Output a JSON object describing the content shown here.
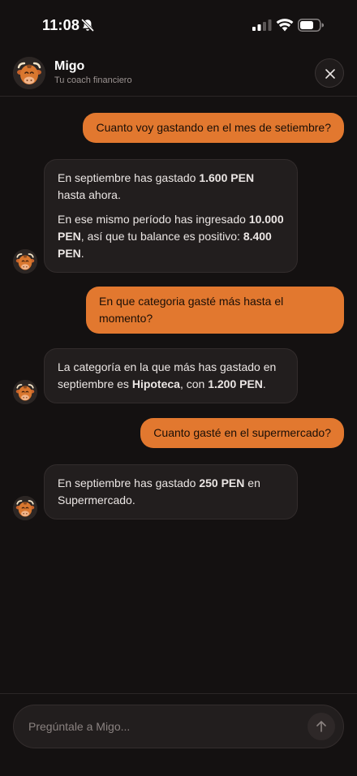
{
  "status_bar": {
    "time": "11:08"
  },
  "header": {
    "name": "Migo",
    "subtitle": "Tu coach financiero"
  },
  "messages": [
    {
      "role": "user",
      "text": "Cuanto voy gastando en el mes de setiembre?"
    },
    {
      "role": "bot",
      "paragraphs": [
        [
          {
            "t": "En septiembre has gastado "
          },
          {
            "t": "1.600 PEN",
            "b": true
          },
          {
            "t": " hasta ahora."
          }
        ],
        [
          {
            "t": "En ese mismo período has ingresado "
          },
          {
            "t": "10.000 PEN",
            "b": true
          },
          {
            "t": ", así que tu balance es positivo: "
          },
          {
            "t": "8.400 PEN",
            "b": true
          },
          {
            "t": "."
          }
        ]
      ]
    },
    {
      "role": "user",
      "text": "En que categoria gasté más hasta el momento?"
    },
    {
      "role": "bot",
      "paragraphs": [
        [
          {
            "t": "La categoría en la que más has gastado en septiembre es "
          },
          {
            "t": "Hipoteca",
            "b": true
          },
          {
            "t": ", con "
          },
          {
            "t": "1.200 PEN",
            "b": true
          },
          {
            "t": "."
          }
        ]
      ]
    },
    {
      "role": "user",
      "text": "Cuanto gasté en el supermercado?"
    },
    {
      "role": "bot",
      "paragraphs": [
        [
          {
            "t": "En septiembre has gastado "
          },
          {
            "t": "250 PEN",
            "b": true
          },
          {
            "t": " en Supermercado."
          }
        ]
      ]
    }
  ],
  "composer": {
    "placeholder": "Pregúntale a Migo..."
  },
  "icons": {
    "avatar": "bull-mascot-icon",
    "close": "close-icon",
    "send": "arrow-up-icon"
  },
  "colors": {
    "accent": "#E2782F",
    "background": "#141111",
    "bot_bubble": "#221E1E"
  }
}
